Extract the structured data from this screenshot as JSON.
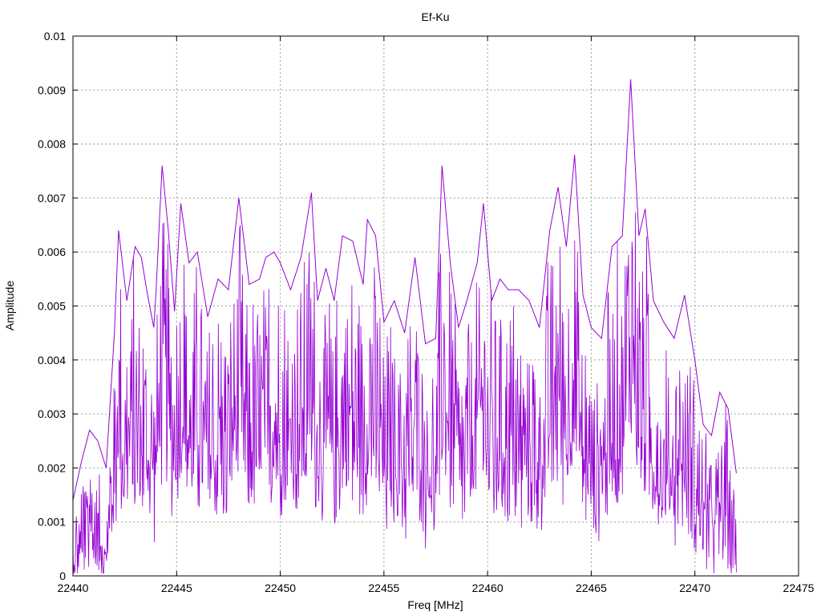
{
  "chart_data": {
    "type": "line",
    "title": "Ef-Ku",
    "xlabel": "Freq [MHz]",
    "ylabel": "Amplitude",
    "xlim": [
      22440,
      22475
    ],
    "ylim": [
      0,
      0.01
    ],
    "x_ticks": [
      22440,
      22445,
      22450,
      22455,
      22460,
      22465,
      22470,
      22475
    ],
    "x_tick_labels": [
      "22440",
      "22445",
      "22450",
      "22455",
      "22460",
      "22465",
      "22470",
      "22475"
    ],
    "y_ticks": [
      0,
      0.001,
      0.002,
      0.003,
      0.004,
      0.005,
      0.006,
      0.007,
      0.008,
      0.009,
      0.01
    ],
    "y_tick_labels": [
      "0",
      "0.001",
      "0.002",
      "0.003",
      "0.004",
      "0.005",
      "0.006",
      "0.007",
      "0.008",
      "0.009",
      "0.01"
    ],
    "grid": true,
    "series": [
      {
        "color": "#9400d3",
        "x": [
          22440.0,
          22440.4,
          22440.8,
          22441.2,
          22441.6,
          22442.0,
          22442.2,
          22442.6,
          22443.0,
          22443.3,
          22443.6,
          22443.9,
          22444.0,
          22444.3,
          22444.6,
          22444.9,
          22445.2,
          22445.6,
          22446.0,
          22446.5,
          22447.0,
          22447.5,
          22448.0,
          22448.5,
          22449.0,
          22449.3,
          22449.7,
          22450.0,
          22450.5,
          22451.0,
          22451.5,
          22451.8,
          22452.2,
          22452.6,
          22453.0,
          22453.5,
          22454.0,
          22454.2,
          22454.6,
          22455.0,
          22455.5,
          22456.0,
          22456.5,
          22457.0,
          22457.5,
          22457.8,
          22458.2,
          22458.6,
          22459.0,
          22459.5,
          22459.8,
          22460.2,
          22460.6,
          22461.0,
          22461.5,
          22462.0,
          22462.5,
          22463.0,
          22463.4,
          22463.8,
          22464.2,
          22464.6,
          22465.0,
          22465.5,
          22466.0,
          22466.5,
          22466.9,
          22467.3,
          22467.6,
          22468.0,
          22468.5,
          22469.0,
          22469.5,
          22470.0,
          22470.4,
          22470.8,
          22471.2,
          22471.6,
          22472.0
        ],
        "y": [
          0.0014,
          0.0021,
          0.0027,
          0.0025,
          0.002,
          0.0045,
          0.0064,
          0.0051,
          0.0061,
          0.0059,
          0.0052,
          0.0046,
          0.0052,
          0.0076,
          0.0064,
          0.0049,
          0.0069,
          0.0058,
          0.006,
          0.0048,
          0.0055,
          0.0053,
          0.007,
          0.0054,
          0.0055,
          0.0059,
          0.006,
          0.0058,
          0.0053,
          0.0059,
          0.0071,
          0.0051,
          0.0057,
          0.0051,
          0.0063,
          0.0062,
          0.0054,
          0.0066,
          0.0063,
          0.0047,
          0.0051,
          0.0045,
          0.0059,
          0.0043,
          0.0044,
          0.0076,
          0.0058,
          0.0046,
          0.0051,
          0.0058,
          0.0069,
          0.0051,
          0.0055,
          0.0053,
          0.0053,
          0.0051,
          0.0046,
          0.0064,
          0.0072,
          0.0061,
          0.0078,
          0.0052,
          0.0046,
          0.0044,
          0.0061,
          0.0063,
          0.0092,
          0.0063,
          0.0068,
          0.0051,
          0.0047,
          0.0044,
          0.0052,
          0.004,
          0.0028,
          0.0026,
          0.0034,
          0.0031,
          0.0019
        ]
      }
    ]
  }
}
